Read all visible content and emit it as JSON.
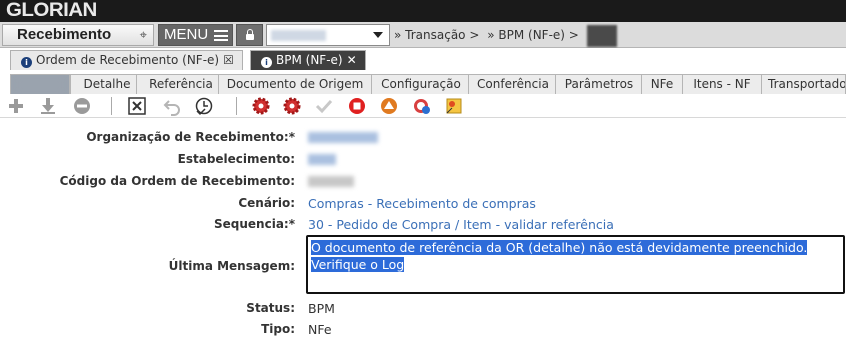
{
  "app": {
    "logo": "GLORIAN"
  },
  "navbar": {
    "module": "Recebimento",
    "menu_label": "MENU",
    "breadcrumb": [
      "» Transação >",
      "» BPM (NF-e) >"
    ]
  },
  "tabs": [
    {
      "label": "Ordem de Recebimento (NF-e)",
      "close": "☒",
      "active": false
    },
    {
      "label": "BPM (NF-e)",
      "close": "✕",
      "active": true
    }
  ],
  "subtabs": [
    "Detalhe",
    "Referência",
    "Documento de Origem",
    "Configuração",
    "Conferência",
    "Parâmetros",
    "NFe",
    "Itens - NF",
    "Transportador"
  ],
  "toolbar_icons": [
    "add-icon",
    "save-icon",
    "remove-icon",
    "close-box-icon",
    "undo-icon",
    "clock-check-icon",
    "gear-red-icon",
    "gear-red-2-icon",
    "check-icon",
    "stop-icon",
    "up-triangle-icon",
    "refresh-icon",
    "settings-star-icon"
  ],
  "form": {
    "org_label": "Organização de Recebimento:*",
    "estab_label": "Estabelecimento:",
    "ordem_label": "Código da Ordem de Recebimento:",
    "cenario_label": "Cenário:",
    "cenario_value": "Compras - Recebimento de compras",
    "sequencia_label": "Sequencia:*",
    "sequencia_value": "30 - Pedido de Compra / Item - validar referência",
    "mensagem_label": "Última Mensagem:",
    "mensagem_line1": "O documento de referência da OR (detalhe) não está devidamente preenchido.",
    "mensagem_line2": "Verifique o Log",
    "status_label": "Status:",
    "status_value": "BPM",
    "tipo_label": "Tipo:",
    "tipo_value": "NFe"
  }
}
